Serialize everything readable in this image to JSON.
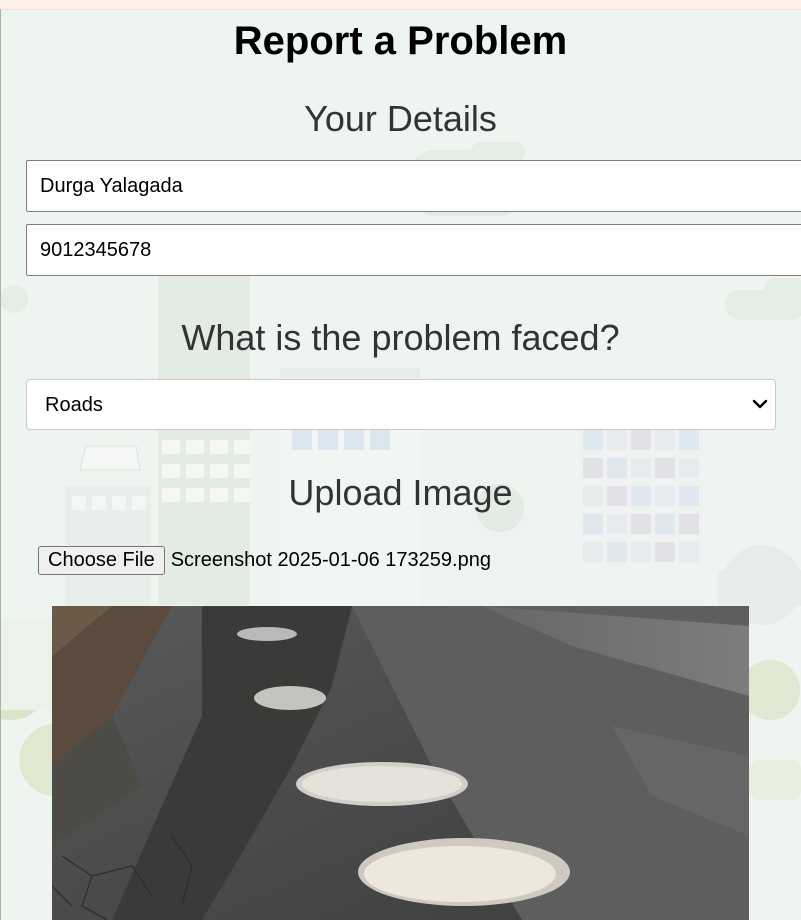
{
  "page": {
    "title": "Report a Problem"
  },
  "details": {
    "heading": "Your Details",
    "name_value": "Durga Yalagada",
    "phone_value": "9012345678"
  },
  "problem": {
    "heading": "What is the problem faced?",
    "selected": "Roads"
  },
  "upload": {
    "heading": "Upload Image",
    "button_label": "Choose File",
    "file_name": "Screenshot 2025-01-06 173259.png"
  },
  "icons": {
    "dropdown": "chevron-down-icon"
  },
  "colors": {
    "background": "#eef4ef",
    "top_strip": "#fdf0ea",
    "heading_text": "#333333"
  }
}
